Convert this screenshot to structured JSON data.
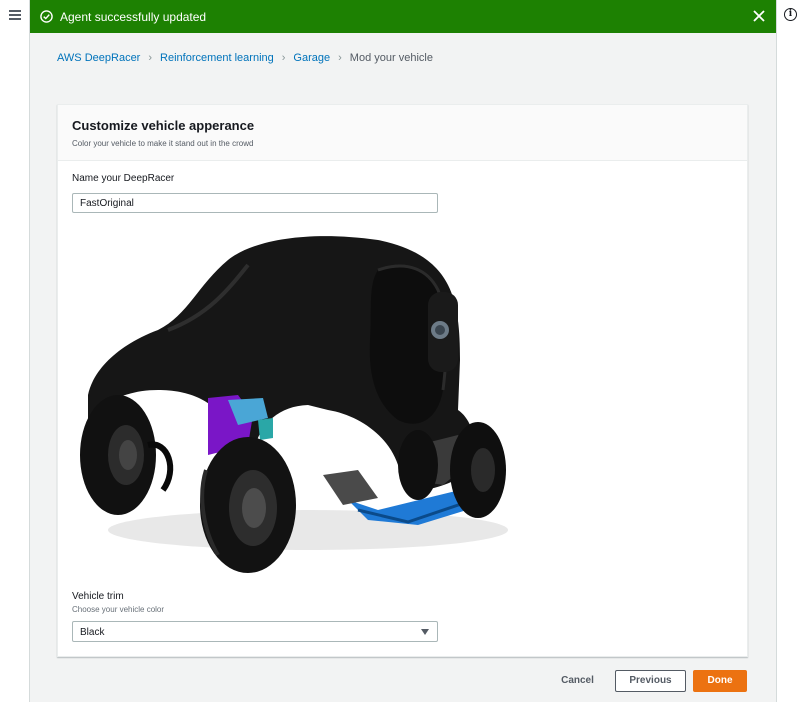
{
  "flash": {
    "message": "Agent successfully updated",
    "color": "#1d8102"
  },
  "breadcrumb": {
    "items": [
      "AWS DeepRacer",
      "Reinforcement learning",
      "Garage"
    ],
    "current": "Mod your vehicle"
  },
  "card": {
    "title": "Customize vehicle apperance",
    "description": "Color your vehicle to make it stand out in the crowd",
    "name_label": "Name your DeepRacer",
    "name_value": "FastOriginal",
    "trim_label": "Vehicle trim",
    "trim_description": "Choose your vehicle color",
    "trim_value": "Black"
  },
  "footer": {
    "cancel": "Cancel",
    "previous": "Previous",
    "done": "Done"
  },
  "colors": {
    "link": "#0073bb",
    "primary": "#ec7211"
  },
  "icons": [
    "menu-icon",
    "info-icon",
    "success-check-icon",
    "close-icon",
    "chevron-right-icon",
    "caret-down-icon"
  ]
}
